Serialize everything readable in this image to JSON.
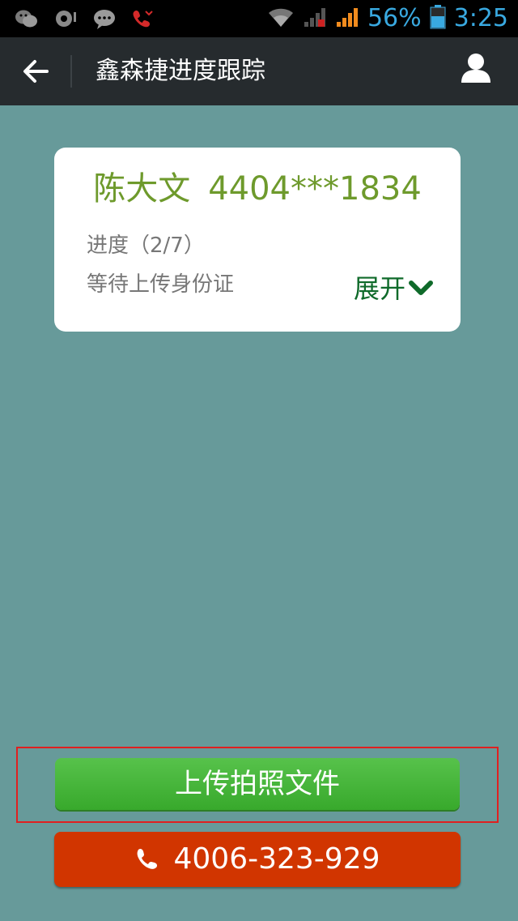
{
  "statusbar": {
    "battery_percent": "56%",
    "time": "3:25",
    "icons": [
      "wechat-icon",
      "chat-bubble-icon",
      "message-icon",
      "missed-call-icon",
      "wifi-icon",
      "signal-icon",
      "signal-strong-icon",
      "battery-icon"
    ]
  },
  "header": {
    "title": "鑫森捷进度跟踪",
    "back_icon": "back-arrow-icon",
    "user_icon": "user-icon"
  },
  "card": {
    "name": "陈大文",
    "id_number": "4404***1834",
    "progress": "进度（2/7）",
    "step": "等待上传身份证",
    "expand_label": "展开"
  },
  "actions": {
    "upload_label": "上传拍照文件",
    "phone_number": "4006-323-929"
  },
  "colors": {
    "background": "#679A9A",
    "header": "#262B2E",
    "name_green": "#6E9A2C",
    "expand_green": "#0F6A2A",
    "upload_green": "#46B23A",
    "phone_red": "#D13500",
    "status_blue": "#39A9E0"
  }
}
